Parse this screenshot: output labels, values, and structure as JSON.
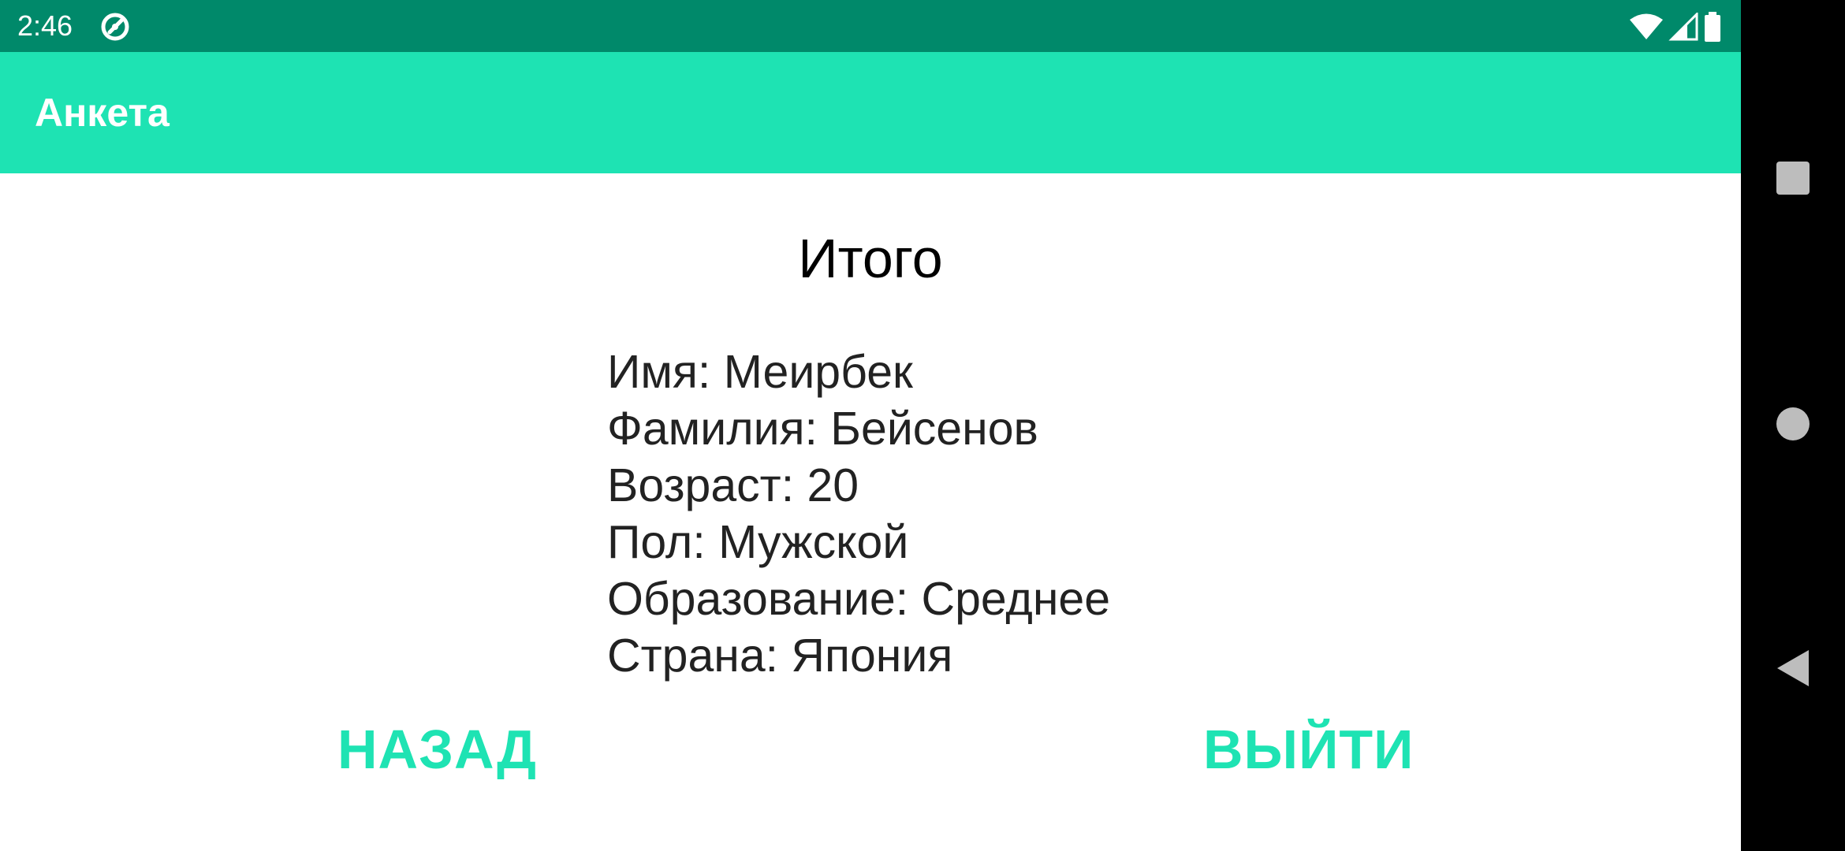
{
  "status_bar": {
    "time": "2:46",
    "background": "#00896a",
    "icons": [
      "app-notification-icon",
      "wifi-icon",
      "cell-signal-icon",
      "battery-icon"
    ]
  },
  "app_bar": {
    "title": "Анкета",
    "background": "#1ee3b3"
  },
  "content": {
    "heading": "Итого",
    "details": [
      "Имя: Меирбек",
      "Фамилия: Бейсенов",
      "Возраст: 20",
      "Пол: Мужской",
      "Образование: Среднее",
      "Страна: Япония"
    ]
  },
  "buttons": {
    "back_label": "НАЗАД",
    "exit_label": "ВЫЙТИ",
    "accent": "#1ee3b3"
  },
  "nav_bar": {
    "icons": [
      "recents-square-icon",
      "home-circle-icon",
      "back-triangle-icon"
    ]
  }
}
